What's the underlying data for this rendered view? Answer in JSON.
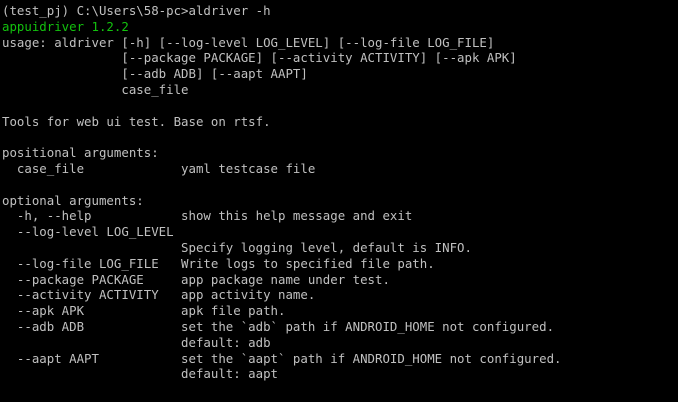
{
  "colors": {
    "background": "#000000",
    "text": "#c0c0c0",
    "version_accent": "#13c10e"
  },
  "lines": [
    "(test_pj) C:\\Users\\58-pc>aldriver -h",
    "appuidriver 1.2.2",
    "usage: aldriver [-h] [--log-level LOG_LEVEL] [--log-file LOG_FILE]",
    "                [--package PACKAGE] [--activity ACTIVITY] [--apk APK]",
    "                [--adb ADB] [--aapt AAPT]",
    "                case_file",
    "",
    "Tools for web ui test. Base on rtsf.",
    "",
    "positional arguments:",
    "  case_file             yaml testcase file",
    "",
    "optional arguments:",
    "  -h, --help            show this help message and exit",
    "  --log-level LOG_LEVEL",
    "                        Specify logging level, default is INFO.",
    "  --log-file LOG_FILE   Write logs to specified file path.",
    "  --package PACKAGE     app package name under test.",
    "  --activity ACTIVITY   app activity name.",
    "  --apk APK             apk file path.",
    "  --adb ADB             set the `adb` path if ANDROID_HOME not configured.",
    "                        default: adb",
    "  --aapt AAPT           set the `aapt` path if ANDROID_HOME not configured.",
    "                        default: aapt"
  ]
}
